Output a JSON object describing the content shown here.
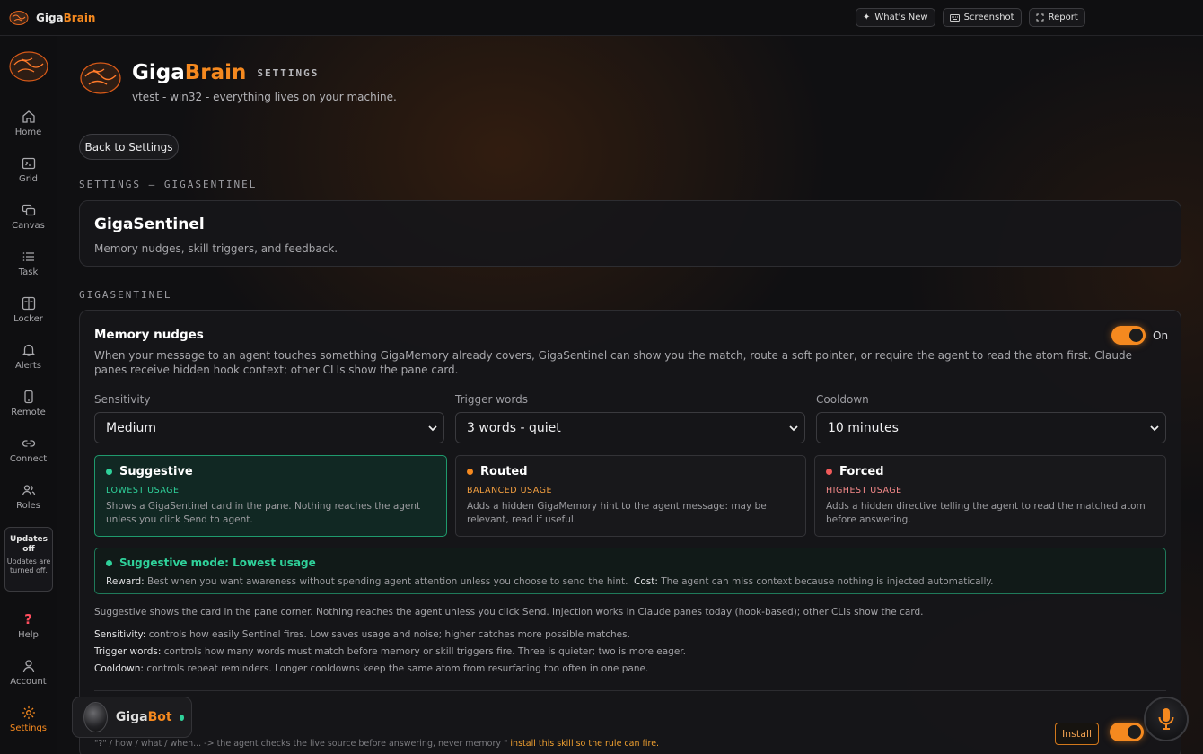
{
  "topbar": {
    "brand_a": "Giga",
    "brand_b": "Brain",
    "buttons": [
      {
        "icon": "sparkle-icon",
        "label": "What's New"
      },
      {
        "icon": "keyboard-icon",
        "label": "Screenshot"
      },
      {
        "icon": "expand-icon",
        "label": "Report"
      }
    ]
  },
  "sidebar": {
    "items": [
      {
        "icon": "home-icon",
        "label": "Home"
      },
      {
        "icon": "terminal-icon",
        "label": "Grid"
      },
      {
        "icon": "canvas-icon",
        "label": "Canvas"
      },
      {
        "icon": "list-icon",
        "label": "Task"
      },
      {
        "icon": "locker-icon",
        "label": "Locker"
      },
      {
        "icon": "bell-icon",
        "label": "Alerts"
      },
      {
        "icon": "phone-icon",
        "label": "Remote"
      },
      {
        "icon": "link-icon",
        "label": "Connect"
      },
      {
        "icon": "users-icon",
        "label": "Roles"
      }
    ],
    "updates_title": "Updates off",
    "updates_text": "Updates are turned off.",
    "bottom": [
      {
        "icon": "help-icon",
        "label": "Help"
      },
      {
        "icon": "account-icon",
        "label": "Account"
      },
      {
        "icon": "settings-gear-icon",
        "label": "Settings"
      }
    ],
    "accent": "#f5891f"
  },
  "header": {
    "title_a": "Giga",
    "title_b": "Brain",
    "tag": "SETTINGS",
    "subtitle": "vtest - win32 - everything lives on your machine."
  },
  "back_button": "Back to Settings",
  "breadcrumb": "SETTINGS — GIGASENTINEL",
  "intro_card": {
    "title": "GigaSentinel",
    "subtitle": "Memory nudges, skill triggers, and feedback."
  },
  "section_label": "GIGASENTINEL",
  "memory_nudges": {
    "title": "Memory nudges",
    "toggle_label": "On",
    "description": "When your message to an agent touches something GigaMemory already covers, GigaSentinel can show you the match, route a soft pointer, or require the agent to read the atom first. Claude panes receive hidden hook context; other CLIs show the pane card.",
    "fields": [
      {
        "label": "Sensitivity",
        "value": "Medium"
      },
      {
        "label": "Trigger words",
        "value": "3 words - quiet"
      },
      {
        "label": "Cooldown",
        "value": "10 minutes"
      }
    ],
    "modes": [
      {
        "name": "Suggestive",
        "usage": "LOWEST USAGE",
        "desc": "Shows a GigaSentinel card in the pane. Nothing reaches the agent unless you click Send to agent.",
        "color": "#2fd19a"
      },
      {
        "name": "Routed",
        "usage": "BALANCED USAGE",
        "desc": "Adds a hidden GigaMemory hint to the agent message: may be relevant, read if useful.",
        "color": "#f5891f"
      },
      {
        "name": "Forced",
        "usage": "HIGHEST USAGE",
        "desc": "Adds a hidden directive telling the agent to read the matched atom before answering.",
        "color": "#f05a5a"
      }
    ],
    "summary": {
      "title": "Suggestive mode: Lowest usage",
      "reward_label": "Reward:",
      "reward": "Best when you want awareness without spending agent attention unless you choose to send the hint.",
      "cost_label": "Cost:",
      "cost": "The agent can miss context because nothing is injected automatically."
    },
    "note_main": "Suggestive shows the card in the pane corner. Nothing reaches the agent unless you click Send. Injection works in Claude panes today (hook-based); other CLIs show the card.",
    "notes": [
      {
        "label": "Sensitivity:",
        "text": "controls how easily Sentinel fires. Low saves usage and noise; higher catches more possible matches."
      },
      {
        "label": "Trigger words:",
        "text": "controls how many words must match before memory or skill triggers fire. Three is quieter; two is more eager."
      },
      {
        "label": "Cooldown:",
        "text": "controls repeat reminders. Longer cooldowns keep the same atom from resurfacing too often in one pane."
      }
    ]
  },
  "footer_line": {
    "text": "\"?\" / how / what / when... -> the agent checks the live source before answering, never memory \"",
    "link": "install this skill so the rule can fire."
  },
  "install_button": "Install",
  "gigabot": {
    "name_a": "Giga",
    "name_b": "Bot",
    "status_color": "#2fd19a"
  }
}
